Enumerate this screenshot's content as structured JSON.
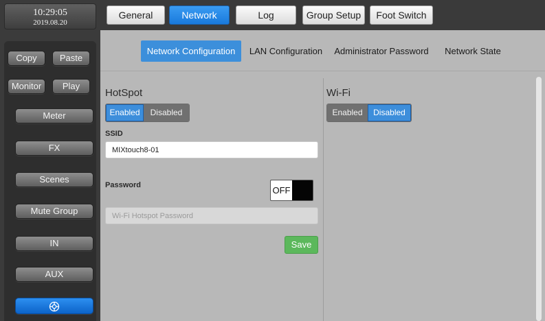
{
  "clock": {
    "time": "10:29:05",
    "date": "2019.08.20"
  },
  "sidebar": {
    "copy": "Copy",
    "paste": "Paste",
    "monitor": "Monitor",
    "play": "Play",
    "meter": "Meter",
    "fx": "FX",
    "scenes": "Scenes",
    "mute_group": "Mute Group",
    "in": "IN",
    "aux": "AUX",
    "bottom_icon": "target-icon"
  },
  "tabs": {
    "general": "General",
    "network": "Network",
    "log": "Log",
    "group_setup": "Group Setup",
    "foot_switch": "Foot Switch",
    "active": "Network"
  },
  "subtabs": {
    "network_configuration": "Network Configuration",
    "lan_configuration": "LAN Configuration",
    "administrator_password": "Administrator Password",
    "network_state": "Network State",
    "active": "Network Configuration"
  },
  "hotspot": {
    "title": "HotSpot",
    "enabled": "Enabled",
    "disabled": "Disabled",
    "state": "Enabled",
    "ssid_label": "SSID",
    "ssid_value": "MIXtouch8-01",
    "password_label": "Password",
    "password_toggle": "OFF",
    "password_placeholder": "Wi-Fi Hotspot Password",
    "save": "Save"
  },
  "wifi": {
    "title": "Wi-Fi",
    "enabled": "Enabled",
    "disabled": "Disabled",
    "state": "Disabled"
  },
  "colors": {
    "accent": "#3c8fdb",
    "save": "#5cb85c",
    "panel": "#b8b8b8",
    "chrome": "#3a3a3a"
  }
}
